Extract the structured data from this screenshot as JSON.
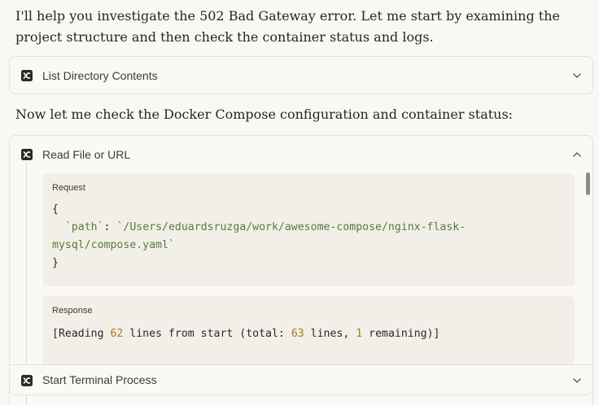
{
  "messages": {
    "intro": "I'll help you investigate the 502 Bad Gateway error. Let me start by examining the project structure and then check the container status and logs.",
    "followup": "Now let me check the Docker Compose configuration and container status:"
  },
  "tools": {
    "list_dir": {
      "title": "List Directory Contents",
      "icon": "desktop-commander-icon",
      "expanded": false
    },
    "read_file": {
      "title": "Read File or URL",
      "icon": "desktop-commander-icon",
      "expanded": true,
      "request_label": "Request",
      "request_open": "{",
      "request_key": "`path`",
      "request_colon": ":",
      "request_value_line1": "`/Users/eduardsruzga/work/awesome-compose/nginx-flask-",
      "request_value_line2": "mysql/compose.yaml`",
      "request_close": "}",
      "response_label": "Response",
      "response_prefix": "[Reading ",
      "response_lines": "62",
      "response_mid": " lines from start (total",
      "response_colon": ":",
      "response_total": "63",
      "response_mid2": " lines, ",
      "response_remaining": "1",
      "response_suffix": " remaining)]"
    },
    "terminal": {
      "title": "Start Terminal Process",
      "icon": "desktop-commander-icon",
      "expanded": false
    }
  }
}
